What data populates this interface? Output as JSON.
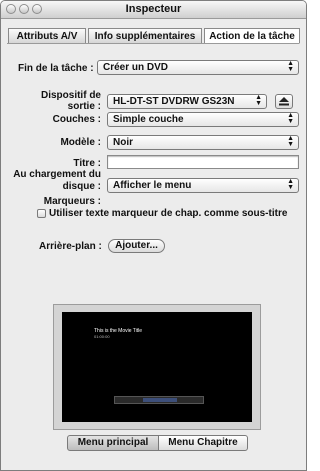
{
  "window": {
    "title": "Inspecteur"
  },
  "tabs": [
    {
      "label": "Attributs A/V",
      "active": false
    },
    {
      "label": "Info supplémentaires",
      "active": false
    },
    {
      "label": "Action de la tâche",
      "active": true
    }
  ],
  "task_end": {
    "label": "Fin de la tâche :",
    "value": "Créer un DVD"
  },
  "output_device": {
    "label_line1": "Dispositif de",
    "label_line2": "sortie :",
    "value": "HL-DT-ST DVDRW  GS23N"
  },
  "layers": {
    "label": "Couches :",
    "value": "Simple couche"
  },
  "template": {
    "label": "Modèle :",
    "value": "Noir"
  },
  "title_field": {
    "label": "Titre :",
    "value": ""
  },
  "on_load": {
    "label_line1": "Au chargement du",
    "label_line2": "disque :",
    "value": "Afficher le menu"
  },
  "markers": {
    "label": "Marqueurs :",
    "checkbox_label": "Utiliser texte marqueur de chap. comme sous-titre",
    "checked": false
  },
  "background": {
    "label": "Arrière-plan :",
    "button_label": "Ajouter..."
  },
  "preview": {
    "movie_title": "This is the Movie Title",
    "movie_subtitle": "01:00:00"
  },
  "menu_segments": [
    {
      "label": "Menu principal",
      "active": true
    },
    {
      "label": "Menu Chapitre",
      "active": false
    }
  ]
}
